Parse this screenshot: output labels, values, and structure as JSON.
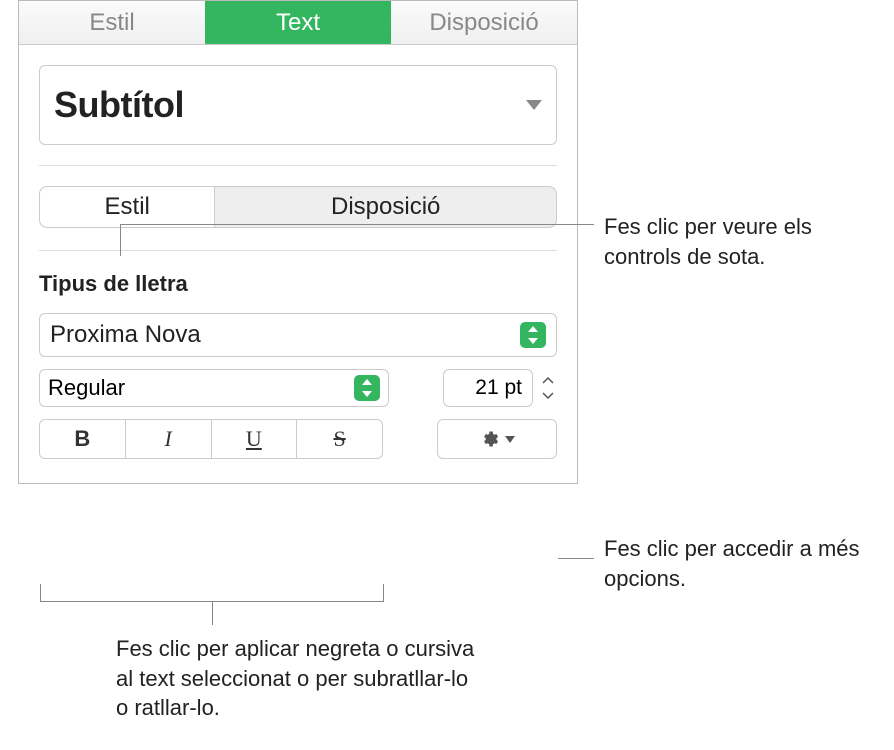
{
  "tabs": {
    "style": "Estil",
    "text": "Text",
    "layout": "Disposició"
  },
  "paragraph_style": {
    "name": "Subtítol"
  },
  "subtabs": {
    "style": "Estil",
    "layout": "Disposició"
  },
  "font": {
    "section_label": "Tipus de lletra",
    "family": "Proxima Nova",
    "weight": "Regular",
    "size": "21 pt",
    "buttons": {
      "bold": "B",
      "italic": "I",
      "underline": "U",
      "strike": "S"
    }
  },
  "callouts": {
    "subtab": "Fes clic per veure els controls de sota.",
    "advanced": "Fes clic per accedir a més opcions.",
    "styles": "Fes clic per aplicar negreta o cursiva al text seleccionat o per subratllar-lo o ratllar-lo."
  }
}
